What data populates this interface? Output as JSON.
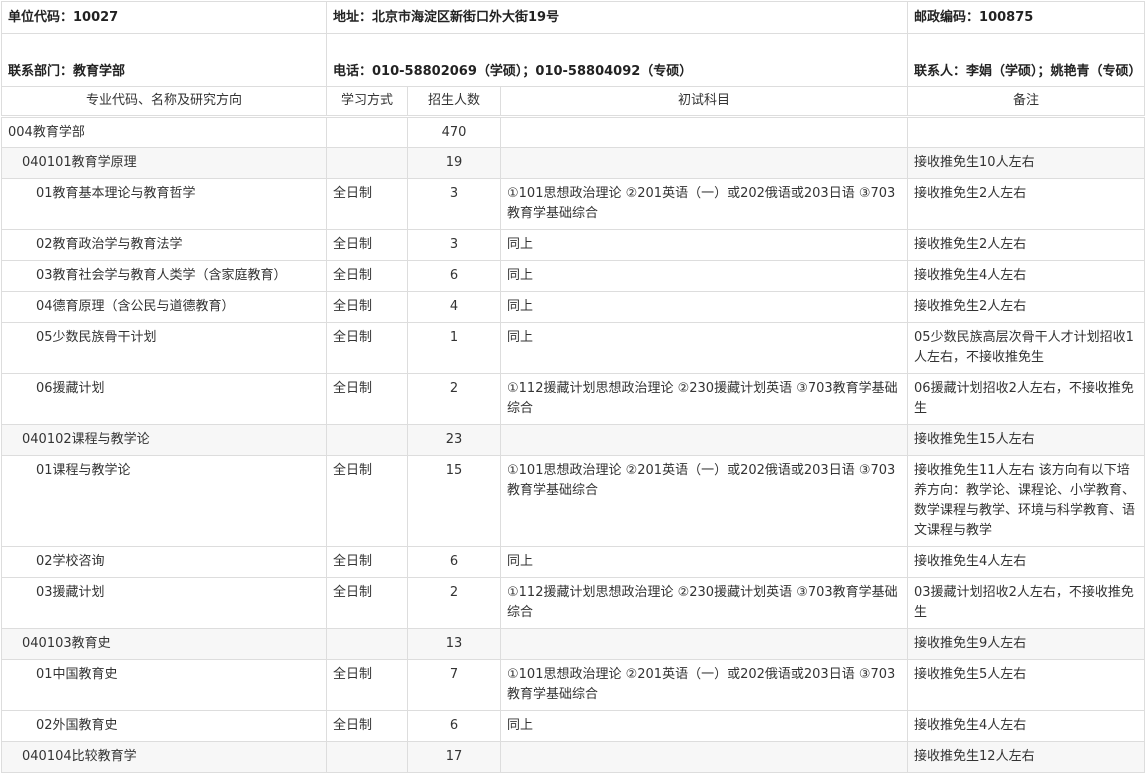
{
  "info": {
    "unit_code": "单位代码：10027",
    "address": "地址：北京市海淀区新街口外大街19号",
    "postal": "邮政编码：100875",
    "department": "联系部门：教育学部",
    "phone": "电话：010-58802069（学硕）；010-58804092（专硕）",
    "contact": "联系人：李娟（学硕）；姚艳青（专硕）"
  },
  "headers": [
    "专业代码、名称及研究方向",
    "学习方式",
    "招生人数",
    "初试科目",
    "备注"
  ],
  "rows": [
    {
      "name": "004教育学部",
      "mode": "",
      "count": "470",
      "subjects": "",
      "note": ""
    },
    {
      "name": "040101教育学原理",
      "mode": "",
      "count": "19",
      "subjects": "",
      "note": "接收推免生10人左右"
    },
    {
      "name": "01教育基本理论与教育哲学",
      "mode": "全日制",
      "count": "3",
      "subjects": "①101思想政治理论 ②201英语（一）或202俄语或203日语 ③703教育学基础综合",
      "note": "接收推免生2人左右"
    },
    {
      "name": "02教育政治学与教育法学",
      "mode": "全日制",
      "count": "3",
      "subjects": "同上",
      "note": "接收推免生2人左右"
    },
    {
      "name": "03教育社会学与教育人类学（含家庭教育）",
      "mode": "全日制",
      "count": "6",
      "subjects": "同上",
      "note": "接收推免生4人左右"
    },
    {
      "name": "04德育原理（含公民与道德教育）",
      "mode": "全日制",
      "count": "4",
      "subjects": "同上",
      "note": "接收推免生2人左右"
    },
    {
      "name": "05少数民族骨干计划",
      "mode": "全日制",
      "count": "1",
      "subjects": "同上",
      "note": "05少数民族高层次骨干人才计划招收1人左右，不接收推免生"
    },
    {
      "name": "06援藏计划",
      "mode": "全日制",
      "count": "2",
      "subjects": "①112援藏计划思想政治理论 ②230援藏计划英语 ③703教育学基础综合",
      "note": "06援藏计划招收2人左右，不接收推免生"
    },
    {
      "name": "040102课程与教学论",
      "mode": "",
      "count": "23",
      "subjects": "",
      "note": "接收推免生15人左右"
    },
    {
      "name": "01课程与教学论",
      "mode": "全日制",
      "count": "15",
      "subjects": "①101思想政治理论 ②201英语（一）或202俄语或203日语 ③703教育学基础综合",
      "note": "接收推免生11人左右 该方向有以下培养方向：教学论、课程论、小学教育、数学课程与教学、环境与科学教育、语文课程与教学"
    },
    {
      "name": "02学校咨询",
      "mode": "全日制",
      "count": "6",
      "subjects": "同上",
      "note": "接收推免生4人左右"
    },
    {
      "name": "03援藏计划",
      "mode": "全日制",
      "count": "2",
      "subjects": "①112援藏计划思想政治理论 ②230援藏计划英语 ③703教育学基础综合",
      "note": "03援藏计划招收2人左右，不接收推免生"
    },
    {
      "name": "040103教育史",
      "mode": "",
      "count": "13",
      "subjects": "",
      "note": "接收推免生9人左右"
    },
    {
      "name": "01中国教育史",
      "mode": "全日制",
      "count": "7",
      "subjects": "①101思想政治理论 ②201英语（一）或202俄语或203日语 ③703教育学基础综合",
      "note": "接收推免生5人左右"
    },
    {
      "name": "02外国教育史",
      "mode": "全日制",
      "count": "6",
      "subjects": "同上",
      "note": "接收推免生4人左右"
    },
    {
      "name": "040104比较教育学",
      "mode": "",
      "count": "17",
      "subjects": "",
      "note": "接收推免生12人左右"
    }
  ]
}
